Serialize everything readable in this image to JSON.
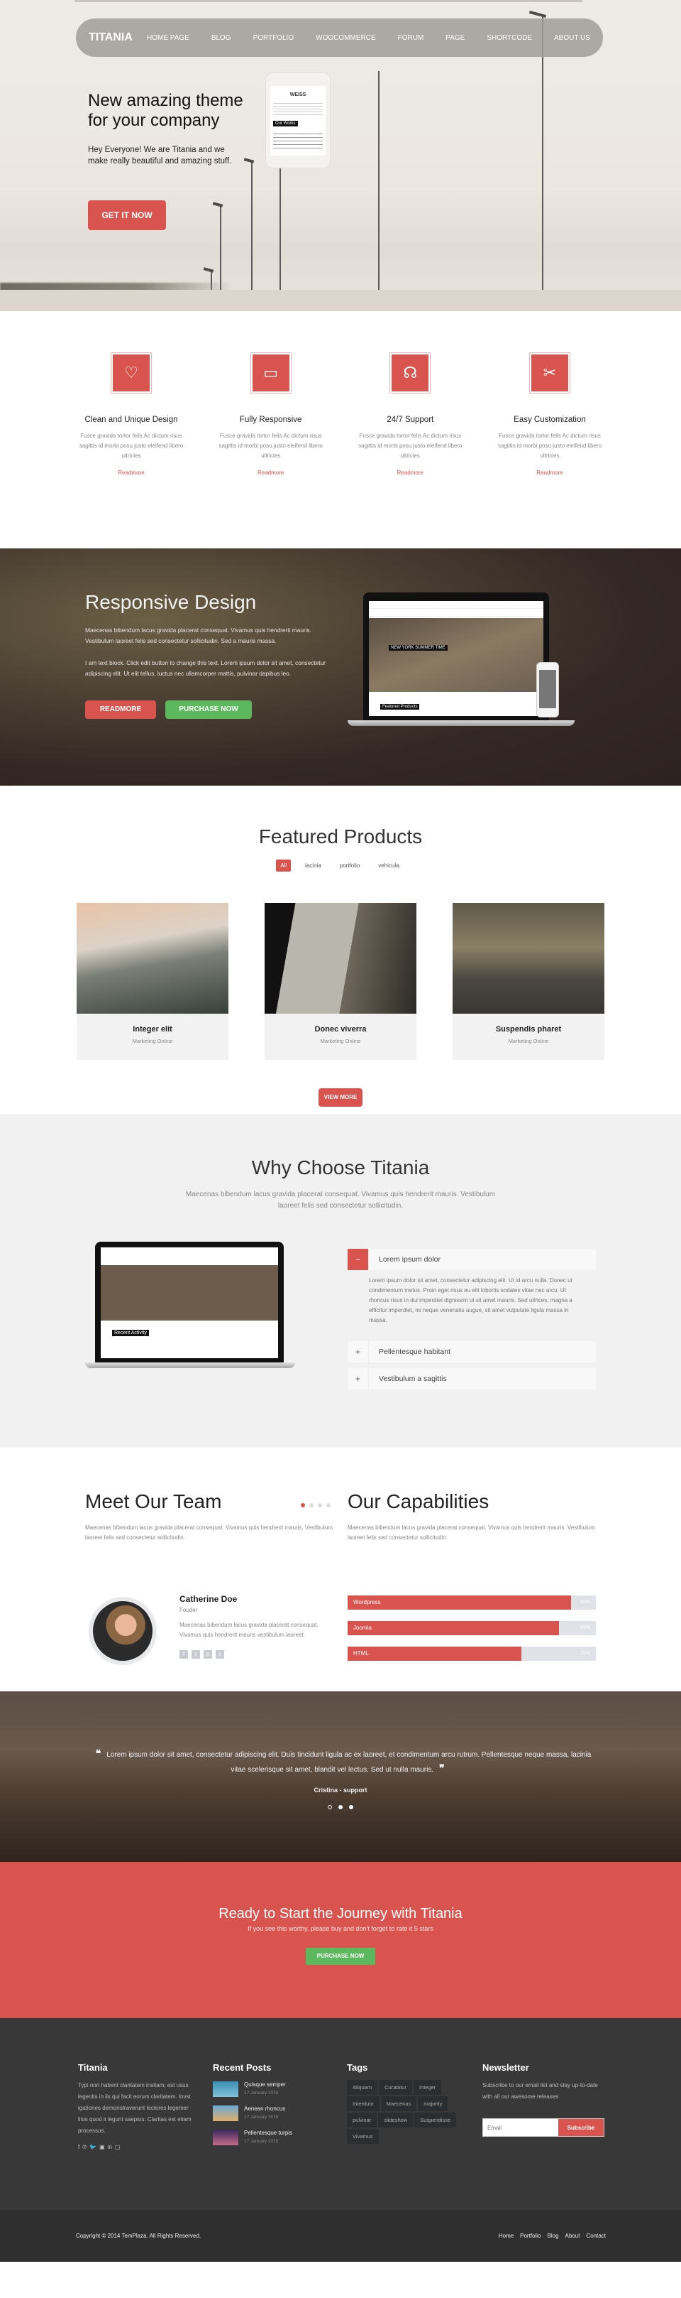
{
  "nav": {
    "logo": "TITANIA",
    "items": [
      "HOME PAGE",
      "BLOG",
      "PORTFOLIO",
      "WOOCOMMERCE",
      "FORUM",
      "PAGE",
      "SHORTCODE",
      "ABOUT US"
    ]
  },
  "hero": {
    "title": "New amazing theme for your company",
    "lead": "Hey Everyone! We are Titania and we make really beautiful and amazing stuff.",
    "cta": "GET IT NOW",
    "phone_brand": "WEISS",
    "phone_section": "Our Works"
  },
  "features": [
    {
      "icon": "heart-icon",
      "glyph": "♡",
      "title": "Clean and Unique Design",
      "text": "Fusce gravida tortor felis Ac dictum risus sagittis id morbi posu justo eleifend libero ultricies",
      "link": "Readmore"
    },
    {
      "icon": "laptop-icon",
      "glyph": "▭",
      "title": "Fully Responsive",
      "text": "Fusce gravida tortor felis Ac dictum risus sagittis id morbi posu justo eleifend libero ultricies",
      "link": "Readmore"
    },
    {
      "icon": "headset-icon",
      "glyph": "☊",
      "title": "24/7 Support",
      "text": "Fusce gravida tortor felis Ac dictum risus sagittis id morbi posu justo eleifend libero ultricies",
      "link": "Readmore"
    },
    {
      "icon": "tools-icon",
      "glyph": "✂",
      "title": "Easy Customization",
      "text": "Fusce gravida tortor felis Ac dictum risus sagittis id morbi posu justo eleifend libero ultricies",
      "link": "Readmore"
    }
  ],
  "responsive": {
    "title": "Responsive Design",
    "p1": "Maecenas bibendum lacus gravida placerat consequat. Vivamus quis hendrerit mauris. Vestibulum laoreet felis sed consectetur sollicitudin. Sed a mauris massa.",
    "p2": "I am text block. Click edit button to change this text. Lorem ipsum dolor sit amet, consectetur adipiscing elit. Ut elit tellus, luctus nec ullamcorper mattis, pulvinar dapibus leo.",
    "readmore": "READMORE",
    "purchase": "PURCHASE NOW",
    "screen_caption": "NEW YORK SUMMER TIME",
    "screen_section": "Featured Products"
  },
  "products": {
    "title": "Featured Products",
    "filters": [
      "All",
      "lacinia",
      "portfolio",
      "vehicula."
    ],
    "active_filter": "All",
    "items": [
      {
        "name": "Integer elit",
        "category": "Marketing Online"
      },
      {
        "name": "Donec viverra",
        "category": "Marketing Online"
      },
      {
        "name": "Suspendis pharet",
        "category": "Marketing Online"
      }
    ],
    "view_more": "VIEW MORE"
  },
  "why": {
    "title": "Why Choose Titania",
    "subtitle": "Maecenas bibendum lacus gravida placerat consequat. Vivamus quis hendrerit mauris. Vestibulum laoreet felis sed consectetur sollicitudin.",
    "screen_caption": "Recent Activity",
    "accordion": [
      {
        "title": "Lorem ipsum dolor",
        "open": true,
        "toggle": "−",
        "body": "Lorem ipsum dolor sit amet, consectetur adipiscing elit. Ut id arcu nulla. Donec ut condimentum metus. Proin eget risus eu elit lobortis sodales vitae nec arcu. Ut rhoncus risus in dui imperdiet dignissim ut sit amet mauris. Sed ultrices, magna a efficitur imperdiet, mi neque venenatis augue, sit amet vulputate ligula massa in massa."
      },
      {
        "title": "Pellentesque habitant",
        "open": false,
        "toggle": "+"
      },
      {
        "title": "Vestibulum a sagittis",
        "open": false,
        "toggle": "+"
      }
    ]
  },
  "team": {
    "title": "Meet Our Team",
    "desc": "Maecenas bibendum lacus gravida placerat consequat. Vivamus quis hendrerit mauris. Vestibulum laoreet felis sed consectetur sollicitudin.",
    "member": {
      "name": "Catherine Doe",
      "role": "Fouder",
      "bio": "Maecenas bibendum lacus gravida placerat consequat. Vivamus quis hendrerit mauris vestibulum laoreet.",
      "social": [
        "f",
        "t",
        "p",
        "t"
      ]
    },
    "slider_pages": 4,
    "slider_active": 1
  },
  "capabilities": {
    "title": "Our Capabilities",
    "desc": "Maecenas bibendum lacus gravida placerat consequat. Vivamus quis hendrerit mauris. Vestibulum laoreet felis sed consectetur sollicitudin.",
    "skills": [
      {
        "label": "Wordpress",
        "percent": 90,
        "percent_label": "90%"
      },
      {
        "label": "Joomla",
        "percent": 85,
        "percent_label": "85%"
      },
      {
        "label": "HTML",
        "percent": 70,
        "percent_label": "70%"
      }
    ]
  },
  "testimonial": {
    "quote": "Lorem ipsum dolor sit amet, consectetur adipiscing elit. Duis tincidunt ligula ac ex laoreet, et condimentum arcu rutrum. Pellentesque neque massa, lacinia vitae scelerisque sit amet, blandit vel lectus. Sed ut nulla mauris.",
    "open_quote": "❝",
    "close_quote": "❞",
    "author": "Cristina - support",
    "pages": 3,
    "active": 1
  },
  "cta": {
    "title": "Ready to Start the Journey with Titania",
    "subtitle": "If you see this worthy, please buy and don't forget to rate it 5 stars",
    "button": "PURCHASE NOW"
  },
  "footer": {
    "about": {
      "title": "Titania",
      "text": "Typi non habent claritatem insitam; est usus legentis in iis qui facit eorum claritatem. Invst igationes demonstraverunt lectores legemer liius quod ii legunt saepius. Claritas est etiam processus.",
      "social": [
        "f",
        "℗",
        "🐦",
        "▣",
        "in",
        "▢",
        ""
      ]
    },
    "posts": {
      "title": "Recent Posts",
      "items": [
        {
          "title": "Quisque semper",
          "date": "17 January 2015"
        },
        {
          "title": "Aenean rhoncus",
          "date": "17 January 2015"
        },
        {
          "title": "Pellentesque turpis",
          "date": "17 January 2015"
        }
      ]
    },
    "tags": {
      "title": "Tags",
      "items": [
        "Aliquam",
        "Curabitur",
        "Integer",
        "Interdum",
        "Maecenas",
        "majority",
        "pulvinar",
        "slideshow",
        "Suspendisse",
        "Vivamus"
      ]
    },
    "newsletter": {
      "title": "Newsletter",
      "text": "Subscribe to our email list and stay up-to-date with all our awesome releases",
      "placeholder": "Email",
      "button": "Subscribe"
    }
  },
  "bottom": {
    "copyright": "Copyright © 2014 TemPlaza. All Rights Reserved.",
    "links": [
      "Home",
      "Portfolio",
      "Blog",
      "About",
      "Contact"
    ]
  }
}
